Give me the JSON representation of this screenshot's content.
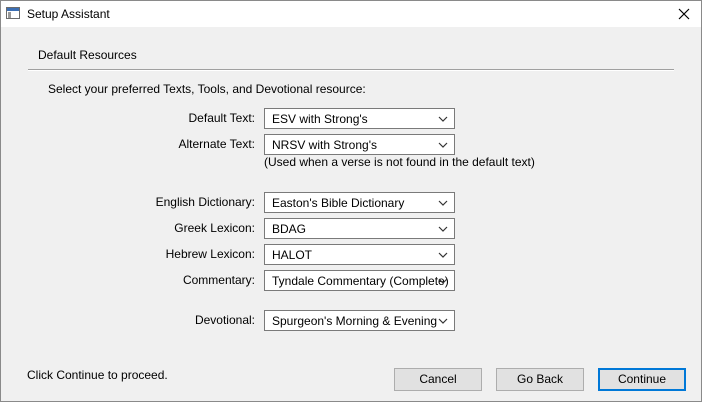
{
  "window": {
    "title": "Setup Assistant"
  },
  "group": {
    "title": "Default Resources",
    "instruction": "Select your preferred Texts, Tools, and Devotional resource:"
  },
  "fields": [
    {
      "label": "Default Text:",
      "value": "ESV with Strong's"
    },
    {
      "label": "Alternate Text:",
      "value": "NRSV with Strong's"
    },
    {
      "label": "English Dictionary:",
      "value": "Easton's Bible Dictionary"
    },
    {
      "label": "Greek Lexicon:",
      "value": "BDAG"
    },
    {
      "label": "Hebrew Lexicon:",
      "value": "HALOT"
    },
    {
      "label": "Commentary:",
      "value": "Tyndale Commentary (Complete)"
    },
    {
      "label": "Devotional:",
      "value": "Spurgeon's Morning & Evening"
    }
  ],
  "alternate_note": "(Used when a verse is not found in the default text)",
  "footer": {
    "text": "Click Continue to proceed.",
    "cancel_label": "Cancel",
    "back_label": "Go Back",
    "continue_label": "Continue"
  },
  "icons": {
    "app": "window-icon",
    "close": "close-icon",
    "dropdown": "chevron-down-icon"
  },
  "colors": {
    "dialog_background": "#f0f0f0",
    "titlebar_background": "#ffffff",
    "default_button_border": "#0078d7"
  }
}
